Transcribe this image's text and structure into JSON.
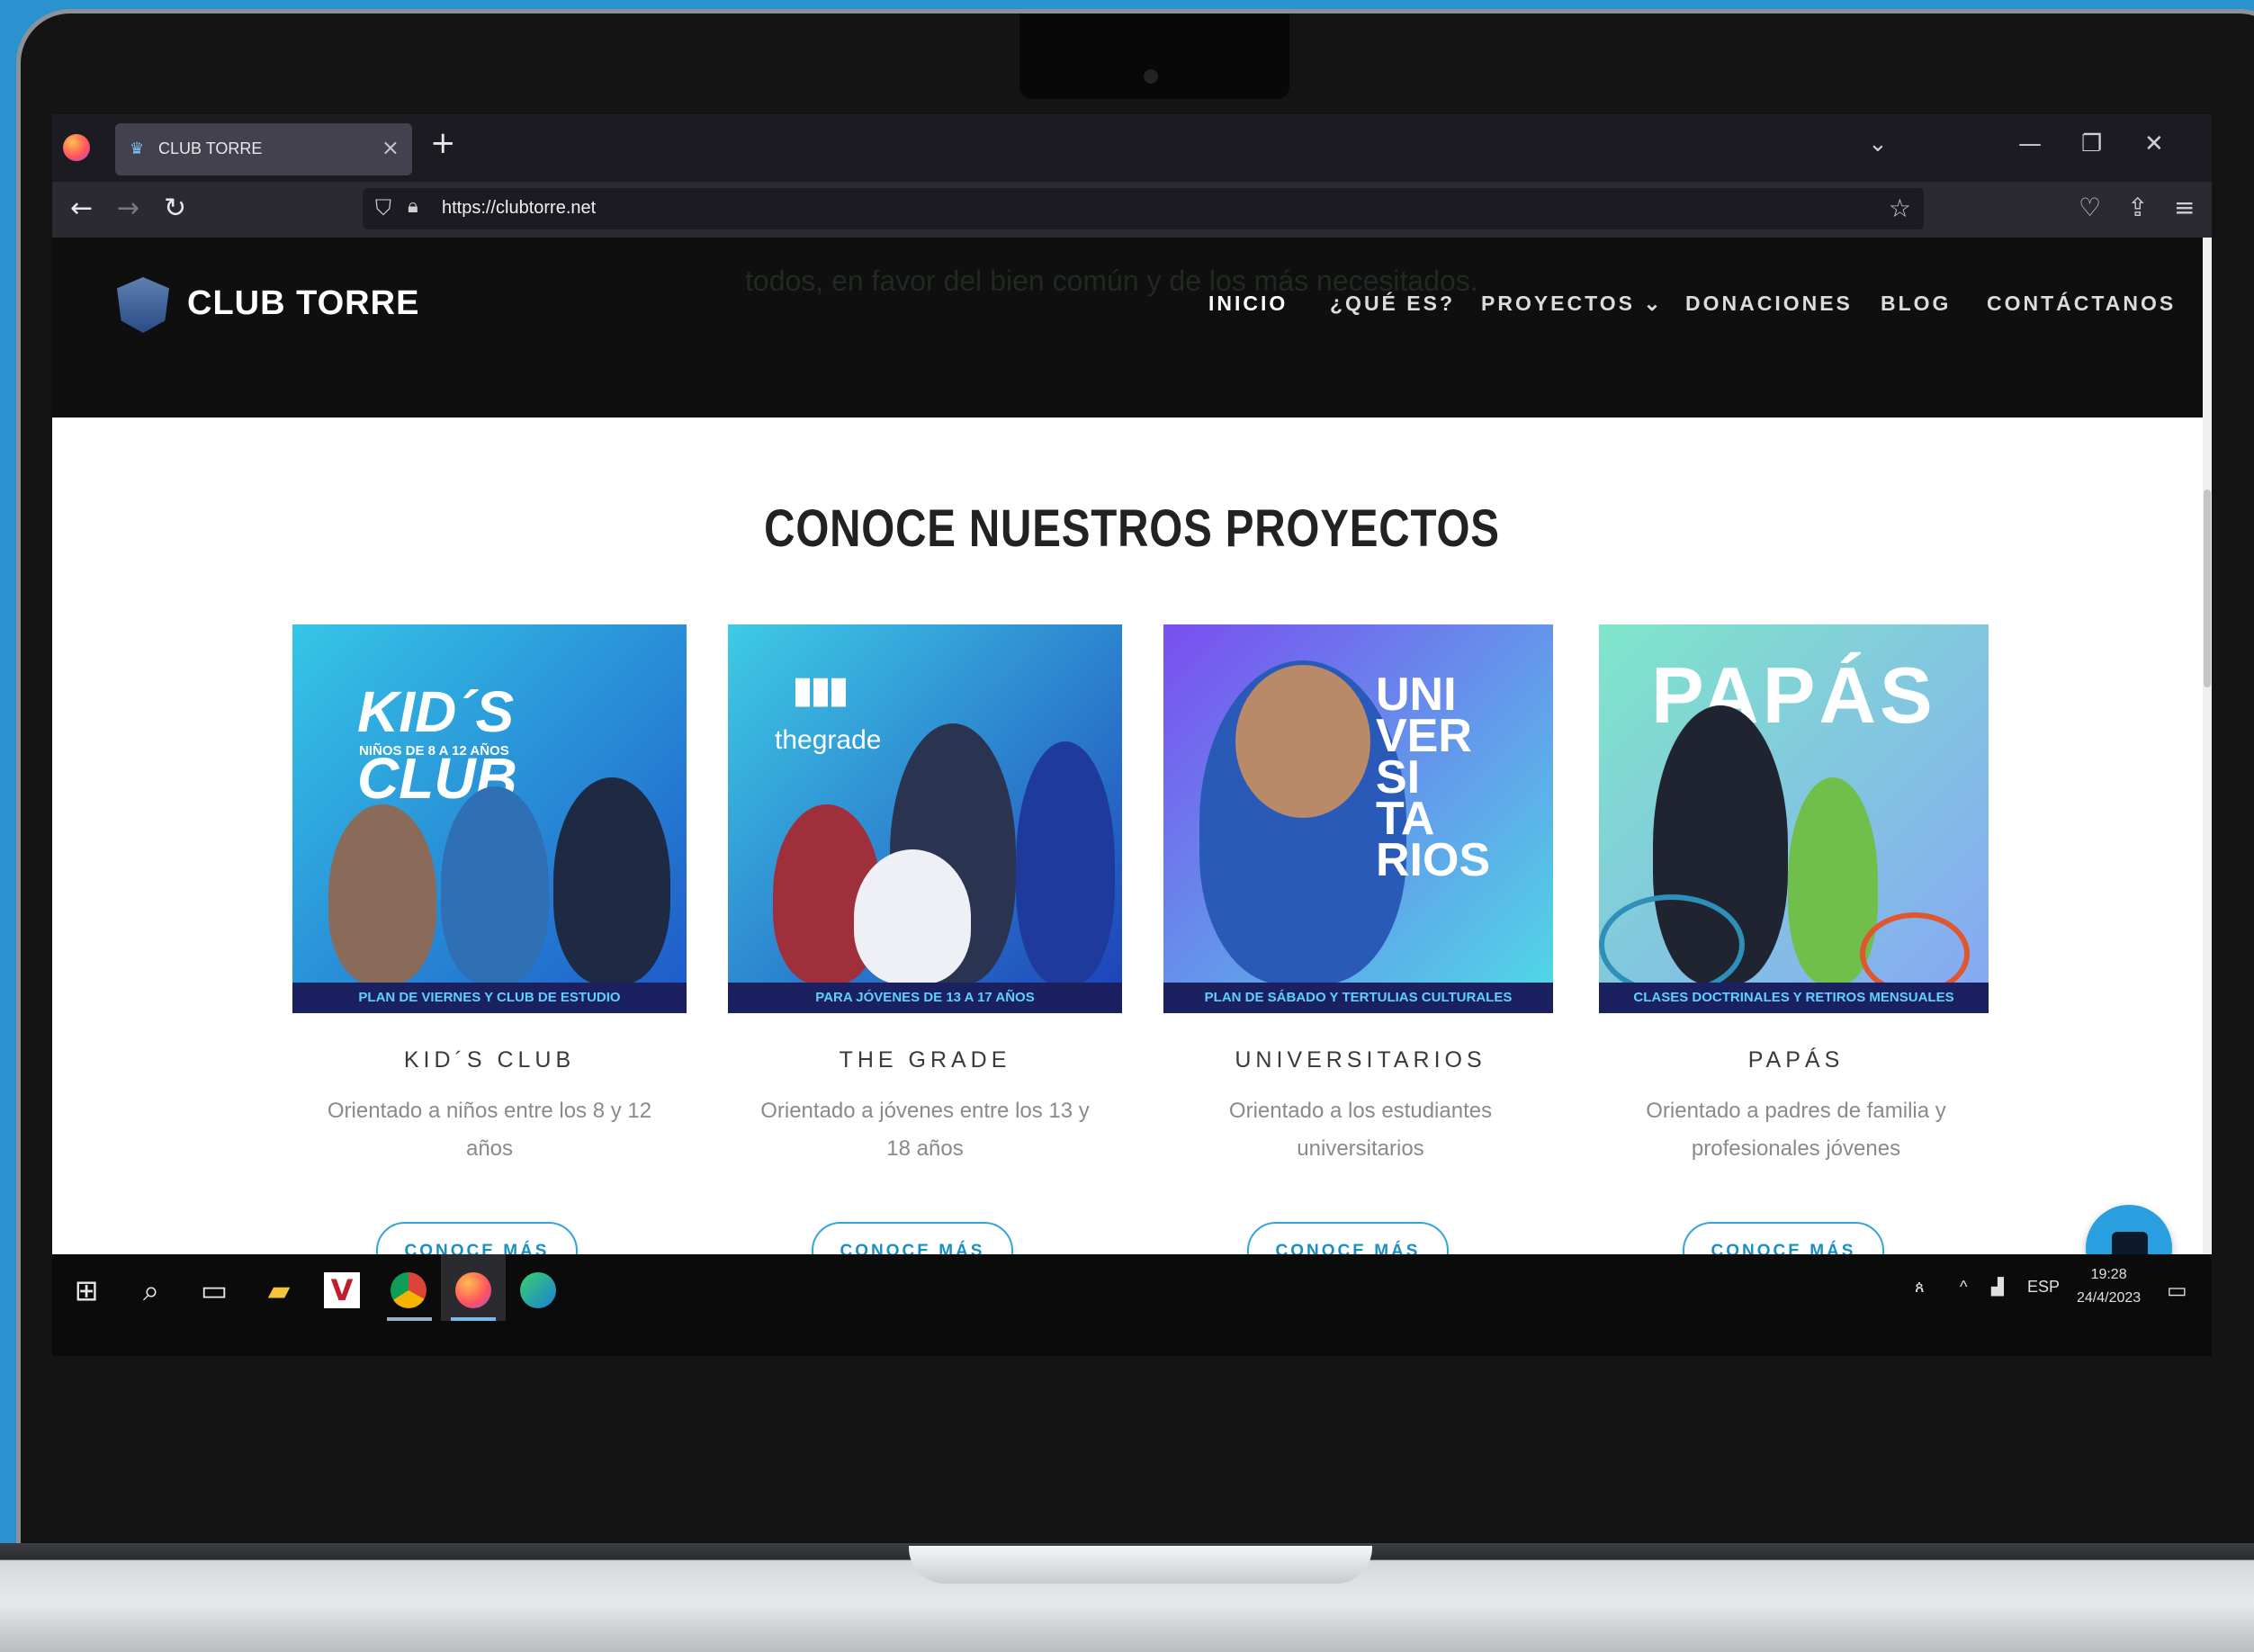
{
  "browser": {
    "tab_title": "CLUB TORRE",
    "tab_close": "×",
    "new_tab": "+",
    "url": "https://clubtorre.net",
    "controls": {
      "list_all_tabs": "⌄",
      "minimize": "—",
      "restore": "❐",
      "close": "✕"
    }
  },
  "site": {
    "logo_text": "CLUB TORRE",
    "background_text": "todos, en favor del bien común y de los más necesitados.",
    "menu": [
      {
        "label": "INICIO",
        "active": true
      },
      {
        "label": "¿QUÉ ES?"
      },
      {
        "label": "PROYECTOS ⌄"
      },
      {
        "label": "DONACIONES"
      },
      {
        "label": "BLOG"
      },
      {
        "label": "CONTÁCTANOS"
      }
    ],
    "section_title": "CONOCE NUESTROS PROYECTOS",
    "cards": [
      {
        "image_title": "KID´S CLUB",
        "image_subtitle": "NIÑOS DE 8 A 12 AÑOS",
        "band": "PLAN DE VIERNES Y CLUB DE ESTUDIO",
        "name": "KID´S CLUB",
        "desc_line1": "Orientado a niños entre los 8 y 12",
        "desc_line2": "años",
        "button": "CONOCE MÁS",
        "gradient": [
          "#35c6e6",
          "#1d58c9"
        ]
      },
      {
        "image_title": "thegrade",
        "band": "PARA JÓVENES DE 13 A 17 AÑOS",
        "name": "THE GRADE",
        "desc_line1": "Orientado a jóvenes entre los 13 y",
        "desc_line2": "18 años",
        "button": "CONOCE MÁS",
        "gradient": [
          "#3ecbe6",
          "#1c3fb8"
        ]
      },
      {
        "image_title_lines": [
          "UNI",
          "VER",
          "SI",
          "TA",
          "RIOS"
        ],
        "band": "PLAN DE SÁBADO Y TERTULIAS CULTURALES",
        "name": "UNIVERSITARIOS",
        "desc_line1": "Orientado a los estudiantes",
        "desc_line2": "universitarios",
        "button": "CONOCE MÁS",
        "gradient": [
          "#7a4ef0",
          "#4fdbe6"
        ]
      },
      {
        "image_title": "PAPÁS",
        "band": "CLASES DOCTRINALES Y RETIROS MENSUALES",
        "name": "PAPÁS",
        "desc_line1": "Orientado a padres de familia y",
        "desc_line2": "profesionales jóvenes",
        "button": "CONOCE MÁS",
        "gradient": [
          "#7fe6c9",
          "#86a6f5"
        ]
      }
    ]
  },
  "taskbar": {
    "language": "ESP",
    "time": "19:28",
    "date": "24/4/2023"
  },
  "colors": {
    "page_background": "#2a93cf",
    "accent": "#35a4d8",
    "header": "#0f0f0f"
  }
}
